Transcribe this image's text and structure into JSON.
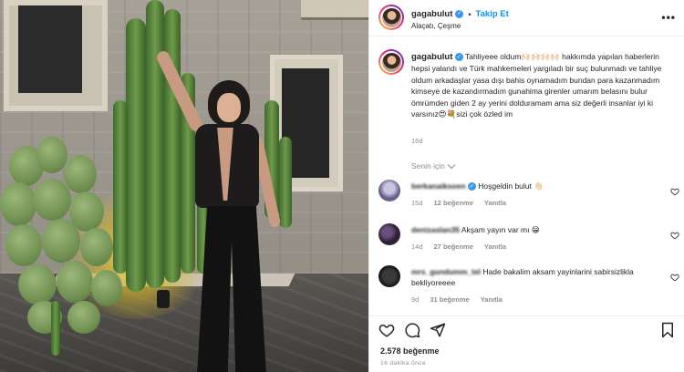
{
  "post_header": {
    "username": "gagabulut",
    "follow_label": "Takip Et",
    "location": "Alaçatı, Çeşme",
    "more_label": "•••"
  },
  "caption": {
    "username": "gagabulut",
    "text": "Tahliyeee oldum🙌🏻🙌🏻🙌🏻🙌🏻 hakkımda yapılan haberlerin hepsi yalandı ve Türk mahkemeleri yargıladı bir suç bulunmadı ve tahliye oldum arkadaşlar yasa dışı bahis oynamadım bundan para kazanmadım kimseye de kazandırmadım gunahima girenler umarım belasını bulur ömrümden giden 2 ay yerini dolduramam ama siz değerli insanlar iyi ki varsınız😍💐sizi çok özled im",
    "time": "16d"
  },
  "filter": {
    "label": "Senin için"
  },
  "comments": [
    {
      "username": "berkanaiksoen",
      "text": "Hoşgeldin bulut 👋🏻",
      "time": "15d",
      "likes": "12 beğenme",
      "reply": "Yanıtla",
      "verified": true
    },
    {
      "username": "denizaslan35",
      "text": "Akşam yayın var mı 😁",
      "time": "14d",
      "likes": "27 beğenme",
      "reply": "Yanıtla",
      "verified": false
    },
    {
      "username": "mrs_gundumm_tel",
      "text": "Hade bakalim aksam yayinlarini sabirsizlikla bekliyoreeee",
      "time": "9d",
      "likes": "31 beğenme",
      "reply": "Yanıtla",
      "verified": false
    }
  ],
  "actions": {
    "likes": "2.578 beğenme",
    "ago": "16 dakika önce"
  },
  "colors": {
    "accent": "#0095f6",
    "verified": "#3897f0",
    "muted": "#8e8e8e",
    "text": "#262626"
  }
}
